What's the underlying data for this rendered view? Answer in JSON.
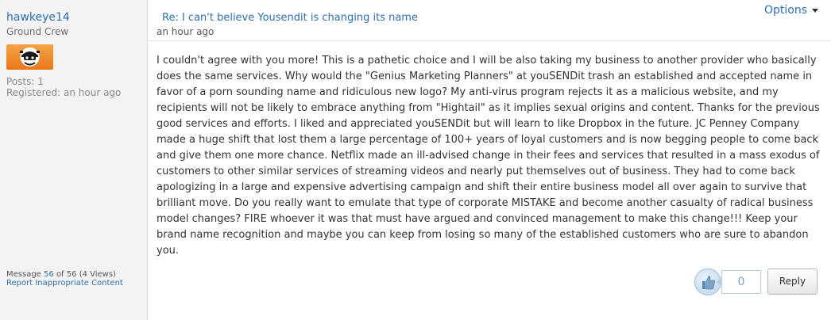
{
  "author": {
    "username": "hawkeye14",
    "rank": "Ground Crew",
    "avatar_icon": "astronaut-avatar-icon",
    "posts": "Posts: 1",
    "registered": "Registered: an hour ago"
  },
  "message_meta": {
    "prefix": "Message",
    "number": "56",
    "of": "of",
    "total": "56",
    "views": "(4 Views)",
    "report_label": "Report Inappropriate Content"
  },
  "post": {
    "subject": "Re: I can't believe Yousendit is changing its name",
    "time": "an hour ago",
    "options_label": "Options",
    "body": "I couldn't agree with you more!  This is a pathetic choice and I will be also taking my business to another provider who basically does the same services.  Why would the \"Genius Marketing Planners\" at youSENDit trash an established and accepted name in favor of a porn sounding name and ridiculous new logo?  My anti-virus program rejects it as a malicious website, and my recipients will not be likely to embrace anything from \"Hightail\" as it implies sexual origins and content.  Thanks for the previous good services and efforts.  I liked and appreciated youSENDit but will learn to like Dropbox in the future.  JC Penney Company made a huge shift that lost them a large percentage of 100+ years of loyal customers and is now begging people to come back and give them one more chance.  Netflix made an ill-advised change in their fees and services that resulted in a mass exodus of customers to other similar services of streaming videos and nearly put themselves out of business.  They had to come back apologizing in a large and expensive advertising campaign and shift their entire business model all over again to survive that brilliant move.  Do you really want to emulate that type of corporate MISTAKE and become another casualty of radical business model changes?  FIRE whoever it was that must have argued and convinced management to make this change!!!  Keep your brand name recognition and maybe you can keep from losing so many of the established customers who are sure to abandon you."
  },
  "actions": {
    "kudos_icon": "thumbs-up-icon",
    "kudos_count": "0",
    "reply_label": "Reply"
  },
  "colors": {
    "link": "#2f6fae",
    "sidebar_bg": "#f3f3f3",
    "avatar_orange": "#e9781b"
  }
}
